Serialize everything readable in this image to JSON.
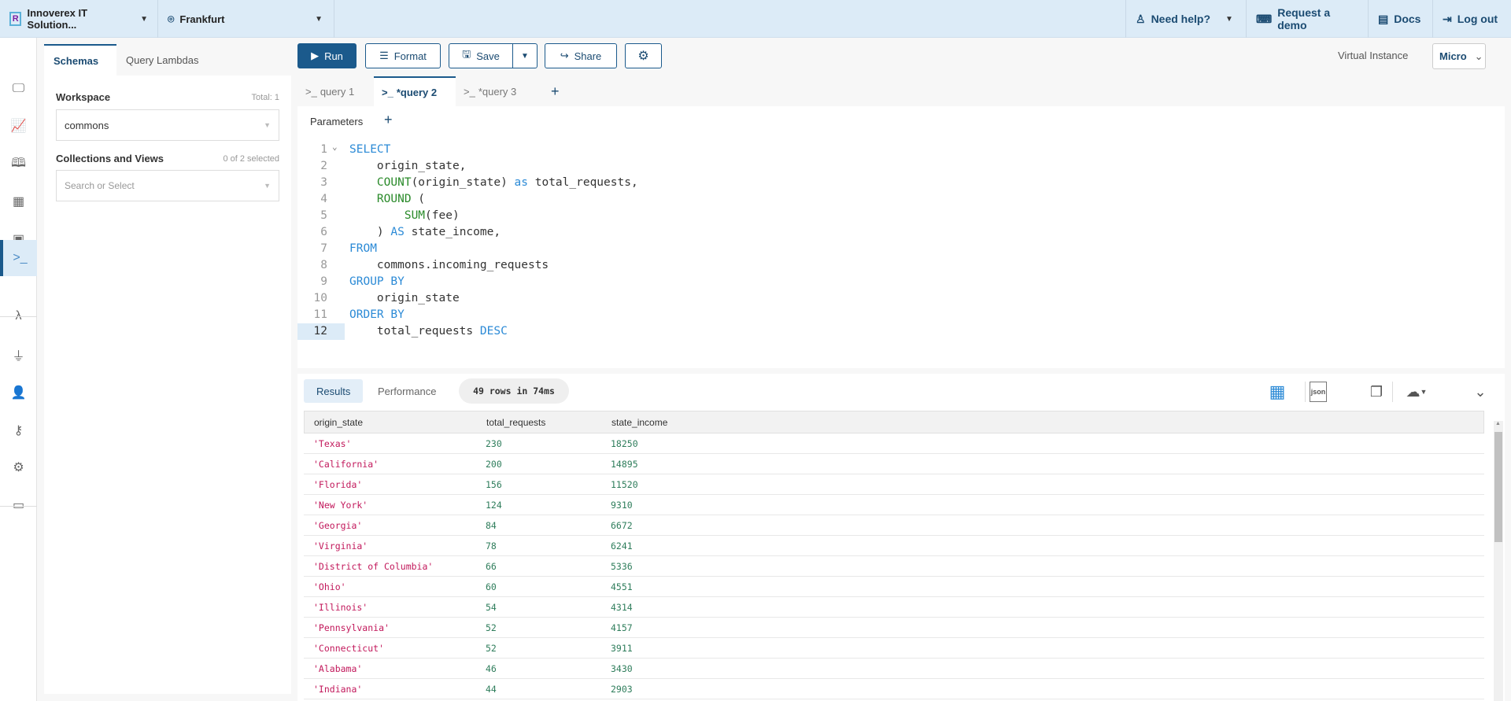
{
  "topbar": {
    "org": "Innoverex IT Solution...",
    "region": "Frankfurt",
    "help": "Need help?",
    "demo": "Request a demo",
    "docs": "Docs",
    "logout": "Log out"
  },
  "sidebar_icons": [
    "monitor-icon",
    "chart-icon",
    "book-icon",
    "table-icon",
    "chip-icon",
    "terminal-icon",
    "lambda-icon",
    "plug-icon",
    "user-gear-icon",
    "key-icon",
    "gear-icon",
    "card-icon"
  ],
  "schemas": {
    "tabs": [
      "Schemas",
      "Query Lambdas"
    ],
    "workspace_label": "Workspace",
    "workspace_total": "Total: 1",
    "workspace_value": "commons",
    "collections_label": "Collections and Views",
    "collections_count": "0 of 2 selected",
    "collections_placeholder": "Search or Select"
  },
  "toolbar": {
    "run": "Run",
    "format": "Format",
    "save": "Save",
    "share": "Share",
    "vi_label": "Virtual Instance",
    "vi_value": "Micro"
  },
  "editor_tabs": [
    "query 1",
    "*query 2",
    "*query 3"
  ],
  "parameters_label": "Parameters",
  "code_lines": [
    {
      "n": "1",
      "t": [
        [
          "kw",
          "SELECT"
        ]
      ]
    },
    {
      "n": "2",
      "t": [
        [
          "",
          "    origin_state,"
        ]
      ]
    },
    {
      "n": "3",
      "t": [
        [
          "",
          "    "
        ],
        [
          "fn",
          "COUNT"
        ],
        [
          "",
          "(origin_state) "
        ],
        [
          "kw",
          "as"
        ],
        [
          "",
          " total_requests,"
        ]
      ]
    },
    {
      "n": "4",
      "t": [
        [
          "",
          "    "
        ],
        [
          "fn",
          "ROUND"
        ],
        [
          "",
          " ("
        ]
      ]
    },
    {
      "n": "5",
      "t": [
        [
          "",
          "        "
        ],
        [
          "fn",
          "SUM"
        ],
        [
          "",
          "(fee)"
        ]
      ]
    },
    {
      "n": "6",
      "t": [
        [
          "",
          "    ) "
        ],
        [
          "kw",
          "AS"
        ],
        [
          "",
          " state_income,"
        ]
      ]
    },
    {
      "n": "7",
      "t": [
        [
          "kw",
          "FROM"
        ]
      ]
    },
    {
      "n": "8",
      "t": [
        [
          "",
          "    commons.incoming_requests"
        ]
      ]
    },
    {
      "n": "9",
      "t": [
        [
          "kw",
          "GROUP BY"
        ]
      ]
    },
    {
      "n": "10",
      "t": [
        [
          "",
          "    origin_state"
        ]
      ]
    },
    {
      "n": "11",
      "t": [
        [
          "kw",
          "ORDER BY"
        ]
      ]
    },
    {
      "n": "12",
      "t": [
        [
          "",
          "    total_requests "
        ],
        [
          "kw",
          "DESC"
        ]
      ]
    }
  ],
  "results": {
    "tabs": [
      "Results",
      "Performance"
    ],
    "summary": "49 rows in 74ms",
    "columns": [
      "origin_state",
      "total_requests",
      "state_income"
    ],
    "rows": [
      [
        "'Texas'",
        "230",
        "18250"
      ],
      [
        "'California'",
        "200",
        "14895"
      ],
      [
        "'Florida'",
        "156",
        "11520"
      ],
      [
        "'New York'",
        "124",
        "9310"
      ],
      [
        "'Georgia'",
        "84",
        "6672"
      ],
      [
        "'Virginia'",
        "78",
        "6241"
      ],
      [
        "'District of Columbia'",
        "66",
        "5336"
      ],
      [
        "'Ohio'",
        "60",
        "4551"
      ],
      [
        "'Illinois'",
        "54",
        "4314"
      ],
      [
        "'Pennsylvania'",
        "52",
        "4157"
      ],
      [
        "'Connecticut'",
        "52",
        "3911"
      ],
      [
        "'Alabama'",
        "46",
        "3430"
      ],
      [
        "'Indiana'",
        "44",
        "2903"
      ]
    ]
  }
}
